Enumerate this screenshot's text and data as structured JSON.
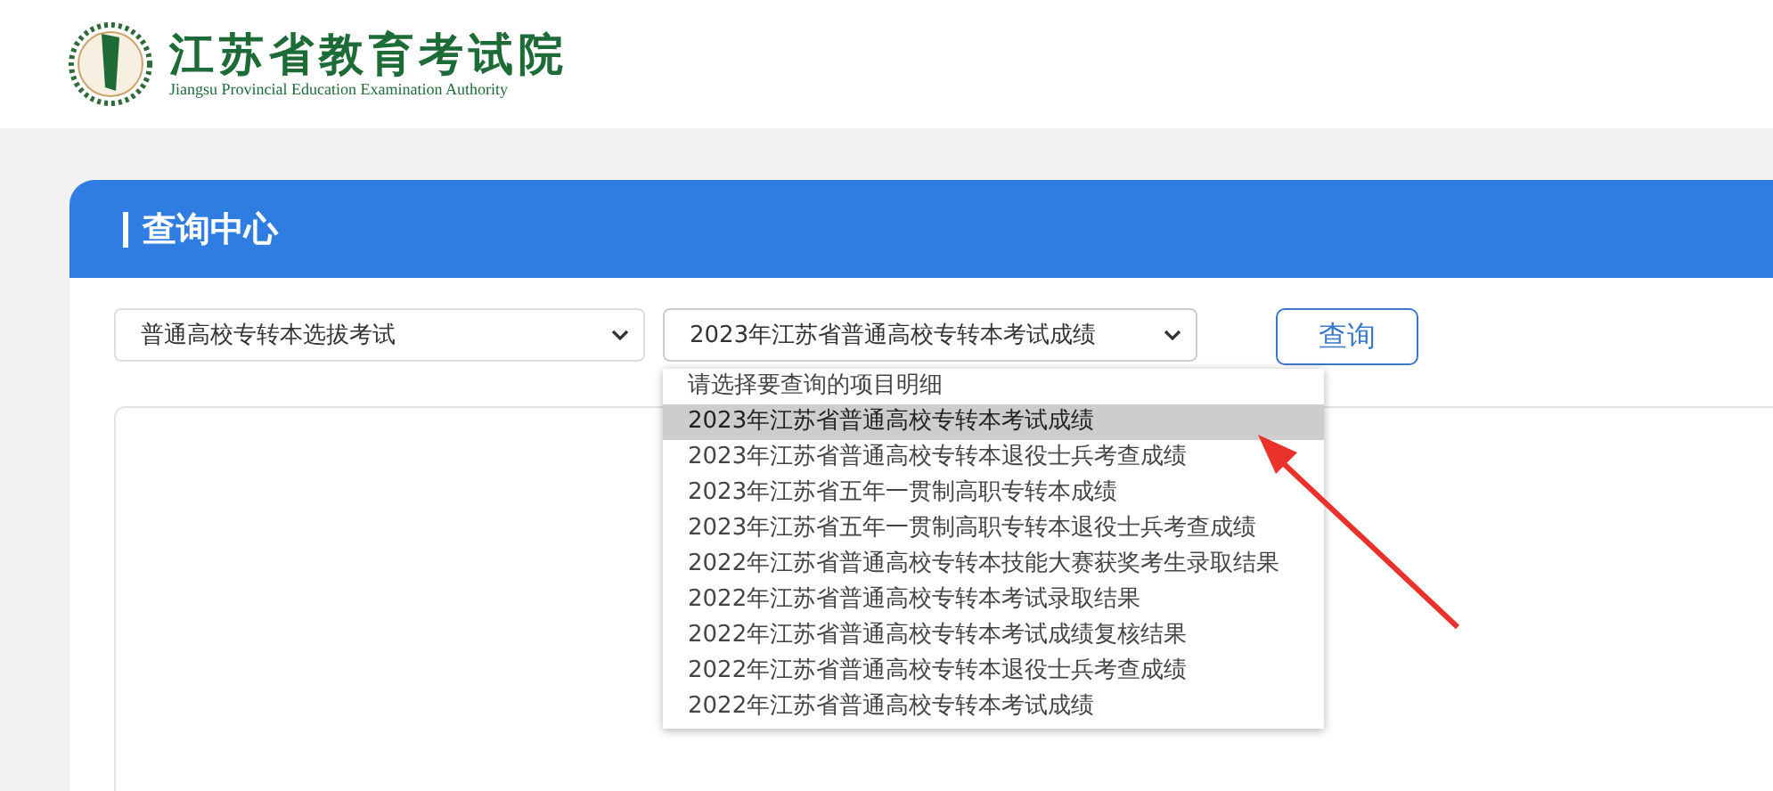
{
  "header": {
    "title": "江苏省教育考试院",
    "subtitle": "Jiangsu Provincial Education Examination Authority"
  },
  "panel": {
    "title": "查询中心"
  },
  "filters": [
    {
      "value": "普通高校专转本选拔考试",
      "expanded": false
    },
    {
      "value": "2023年江苏省普通高校专转本考试成绩",
      "expanded": true
    }
  ],
  "query_button": "查询",
  "dropdown": {
    "options": [
      {
        "label": "请选择要查询的项目明细",
        "selected": false
      },
      {
        "label": "2023年江苏省普通高校专转本考试成绩",
        "selected": true
      },
      {
        "label": "2023年江苏省普通高校专转本退役士兵考查成绩",
        "selected": false
      },
      {
        "label": "2023年江苏省五年一贯制高职专转本成绩",
        "selected": false
      },
      {
        "label": "2023年江苏省五年一贯制高职专转本退役士兵考查成绩",
        "selected": false
      },
      {
        "label": "2022年江苏省普通高校专转本技能大赛获奖考生录取结果",
        "selected": false
      },
      {
        "label": "2022年江苏省普通高校专转本考试录取结果",
        "selected": false
      },
      {
        "label": "2022年江苏省普通高校专转本考试成绩复核结果",
        "selected": false
      },
      {
        "label": "2022年江苏省普通高校专转本退役士兵考查成绩",
        "selected": false
      },
      {
        "label": "2022年江苏省普通高校专转本考试成绩",
        "selected": false
      }
    ]
  }
}
